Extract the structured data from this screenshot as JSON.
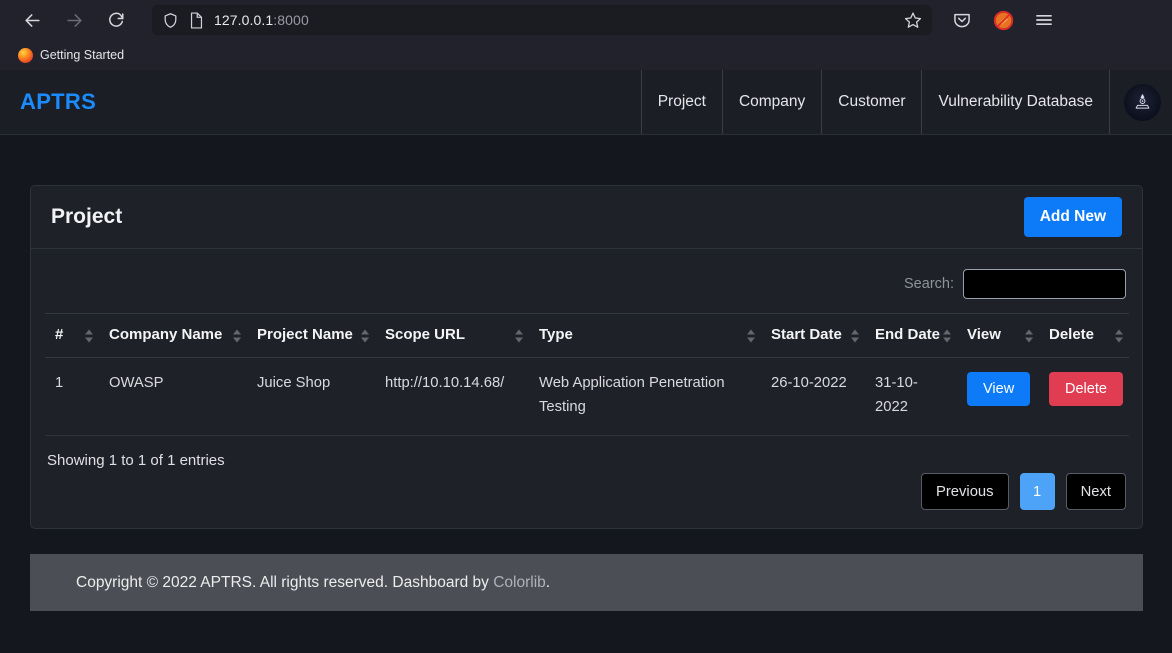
{
  "browser": {
    "back_icon": "back-arrow-icon",
    "forward_icon": "forward-arrow-icon",
    "reload_icon": "reload-icon",
    "shield_icon": "shield-icon",
    "page_icon": "page-document-icon",
    "url_host": "127.0.0.1",
    "url_port": ":8000",
    "bookmark_star_icon": "star-icon",
    "pocket_icon": "pocket-icon",
    "extension_icon": "blocked-extension-icon",
    "menu_icon": "hamburger-menu-icon",
    "bookmark_label": "Getting Started"
  },
  "navbar": {
    "brand": "APTRS",
    "links": [
      {
        "label": "Project"
      },
      {
        "label": "Company"
      },
      {
        "label": "Customer"
      },
      {
        "label": "Vulnerability Database"
      }
    ],
    "avatar_icon": "user-avatar-icon"
  },
  "card": {
    "title": "Project",
    "add_button": "Add New",
    "search_label": "Search:",
    "search_value": "",
    "search_placeholder": ""
  },
  "table": {
    "columns": [
      {
        "label": "#",
        "sortable": true
      },
      {
        "label": "Company Name",
        "sortable": true
      },
      {
        "label": "Project Name",
        "sortable": true
      },
      {
        "label": "Scope URL",
        "sortable": true
      },
      {
        "label": "Type",
        "sortable": true
      },
      {
        "label": "Start Date",
        "sortable": true
      },
      {
        "label": "End Date",
        "sortable": true
      },
      {
        "label": "View",
        "sortable": true
      },
      {
        "label": "Delete",
        "sortable": true
      }
    ],
    "rows": [
      {
        "index": "1",
        "company_name": "OWASP",
        "project_name": "Juice Shop",
        "scope_url": "http://10.10.14.68/",
        "type": "Web Application Penetration Testing",
        "start_date": "26-10-2022",
        "end_date": "31-10-2022",
        "view_label": "View",
        "delete_label": "Delete"
      }
    ],
    "entries_info": "Showing 1 to 1 of 1 entries",
    "pagination": {
      "previous": "Previous",
      "pages": [
        "1"
      ],
      "next": "Next",
      "active_page": "1"
    }
  },
  "footer": {
    "text_before": "Copyright © 2022 APTRS. All rights reserved. Dashboard by ",
    "link": "Colorlib",
    "text_after": "."
  },
  "colors": {
    "brand": "#1a8cff",
    "primary_button": "#0d7bf7",
    "danger_button": "#e03d52",
    "active_page": "#4da3f7",
    "page_background": "#14171d",
    "card_background": "#1e2127",
    "footer_background": "#4b4e54"
  }
}
